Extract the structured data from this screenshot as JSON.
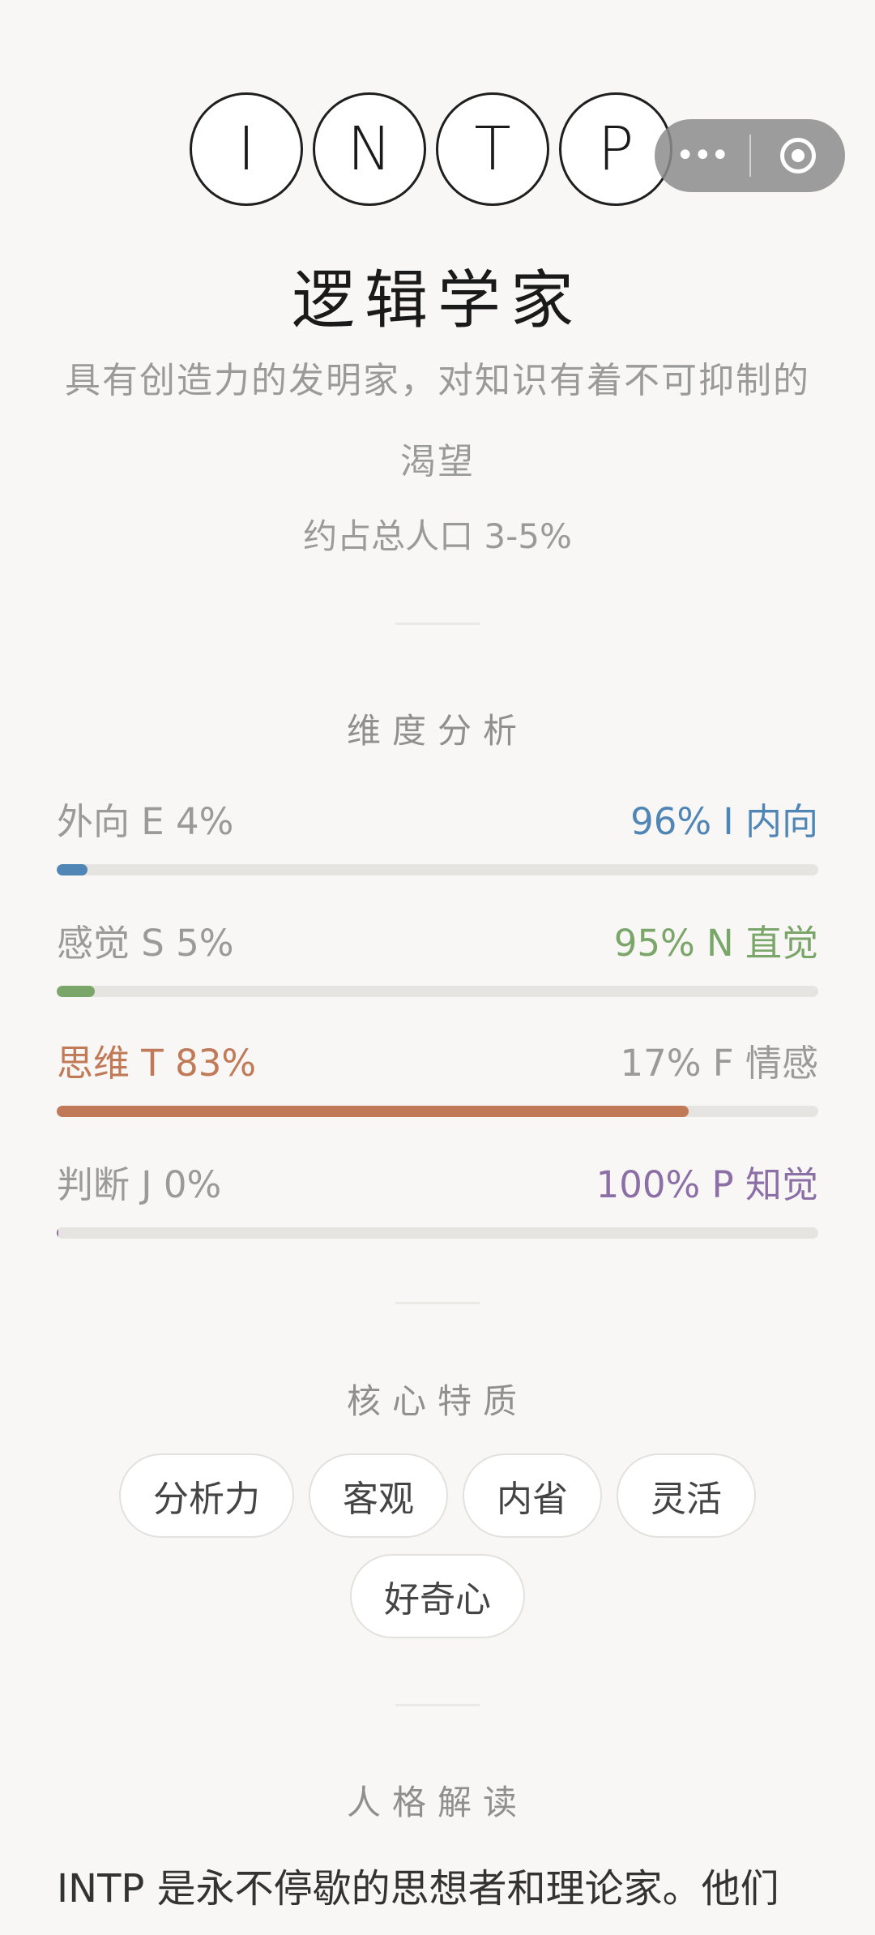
{
  "type_letters": [
    "I",
    "N",
    "T",
    "P"
  ],
  "title": "逻辑学家",
  "description": "具有创造力的发明家，对知识有着不可抑制的渴望",
  "population": "约占总人口 3-5%",
  "sections": {
    "dimensions": "维度分析",
    "traits": "核心特质",
    "reading": "人格解读"
  },
  "dimensions": [
    {
      "left": "外向 E  4%",
      "right": "96%  I 内向",
      "percent": 4,
      "color": "#4f86b6",
      "highlight": "right"
    },
    {
      "left": "感觉 S  5%",
      "right": "95%  N 直觉",
      "percent": 5,
      "color": "#7aa66a",
      "highlight": "right"
    },
    {
      "left": "思维 T  83%",
      "right": "17%  F 情感",
      "percent": 83,
      "color": "#c07a58",
      "highlight": "left"
    },
    {
      "left": "判断 J  0%",
      "right": "100%  P 知觉",
      "percent": 0,
      "color": "#8c6fa6",
      "highlight": "right"
    }
  ],
  "traits": [
    "分析力",
    "客观",
    "内省",
    "灵活",
    "好奇心"
  ],
  "reading_text": "INTP 是永不停歇的思想者和理论家。他们",
  "capsule": {
    "more_icon": "more-dots-icon",
    "close_icon": "target-circle-icon"
  }
}
